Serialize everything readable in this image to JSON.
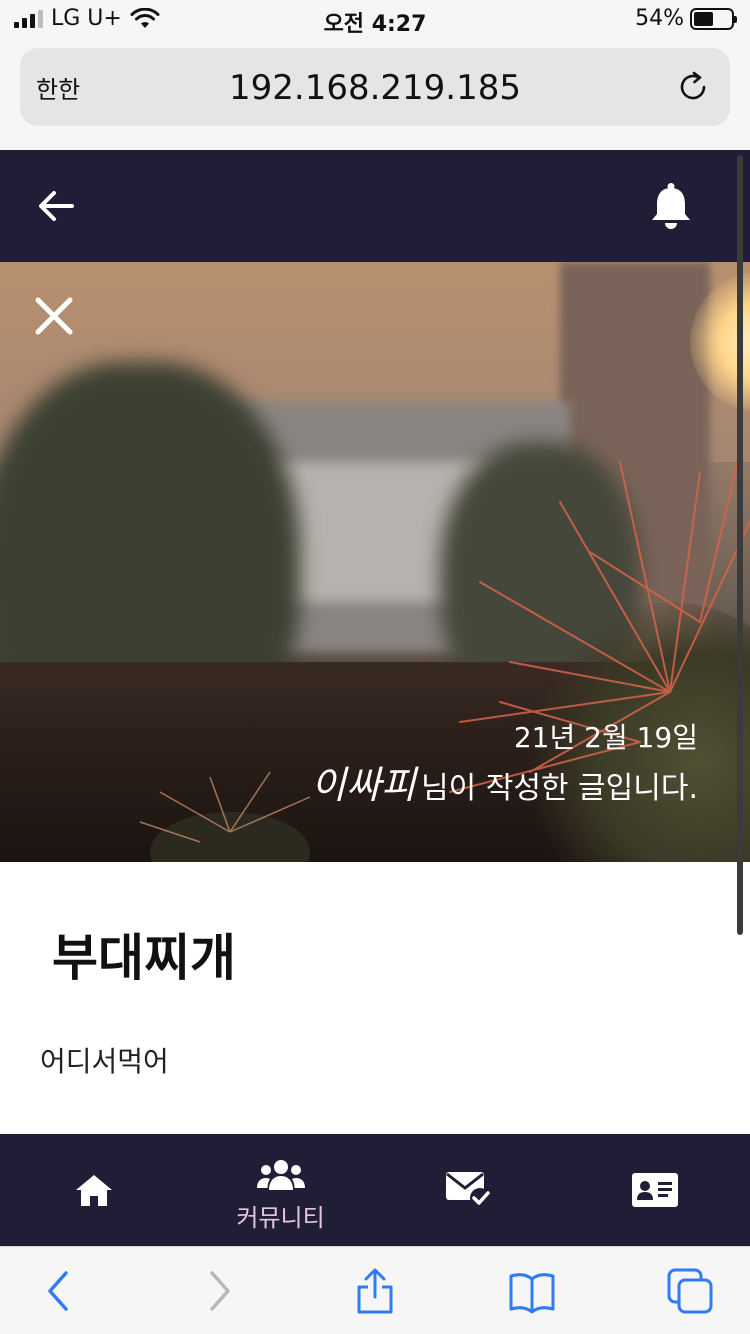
{
  "status_bar": {
    "carrier": "LG U+",
    "time": "오전 4:27",
    "battery": "54%",
    "battery_level": 0.54
  },
  "browser": {
    "reader_label": "한한",
    "url": "192.168.219.185"
  },
  "header": {
    "back_icon": "arrow-left-icon",
    "bell_icon": "bell-icon"
  },
  "post": {
    "date": "21년 2월 19일",
    "author": "이싸피",
    "author_suffix": "님이 작성한 글입니다.",
    "title": "부대찌개",
    "content": "어디서먹어"
  },
  "bottom_nav": {
    "items": [
      {
        "icon": "home-icon",
        "label": ""
      },
      {
        "icon": "users-icon",
        "label": "커뮤니티"
      },
      {
        "icon": "mail-check-icon",
        "label": ""
      },
      {
        "icon": "id-card-icon",
        "label": ""
      }
    ],
    "active_index": 1
  },
  "colors": {
    "header_bg": "#201e36",
    "nav_label": "#e3c6dc",
    "safari_blue": "#2f7cf6"
  }
}
